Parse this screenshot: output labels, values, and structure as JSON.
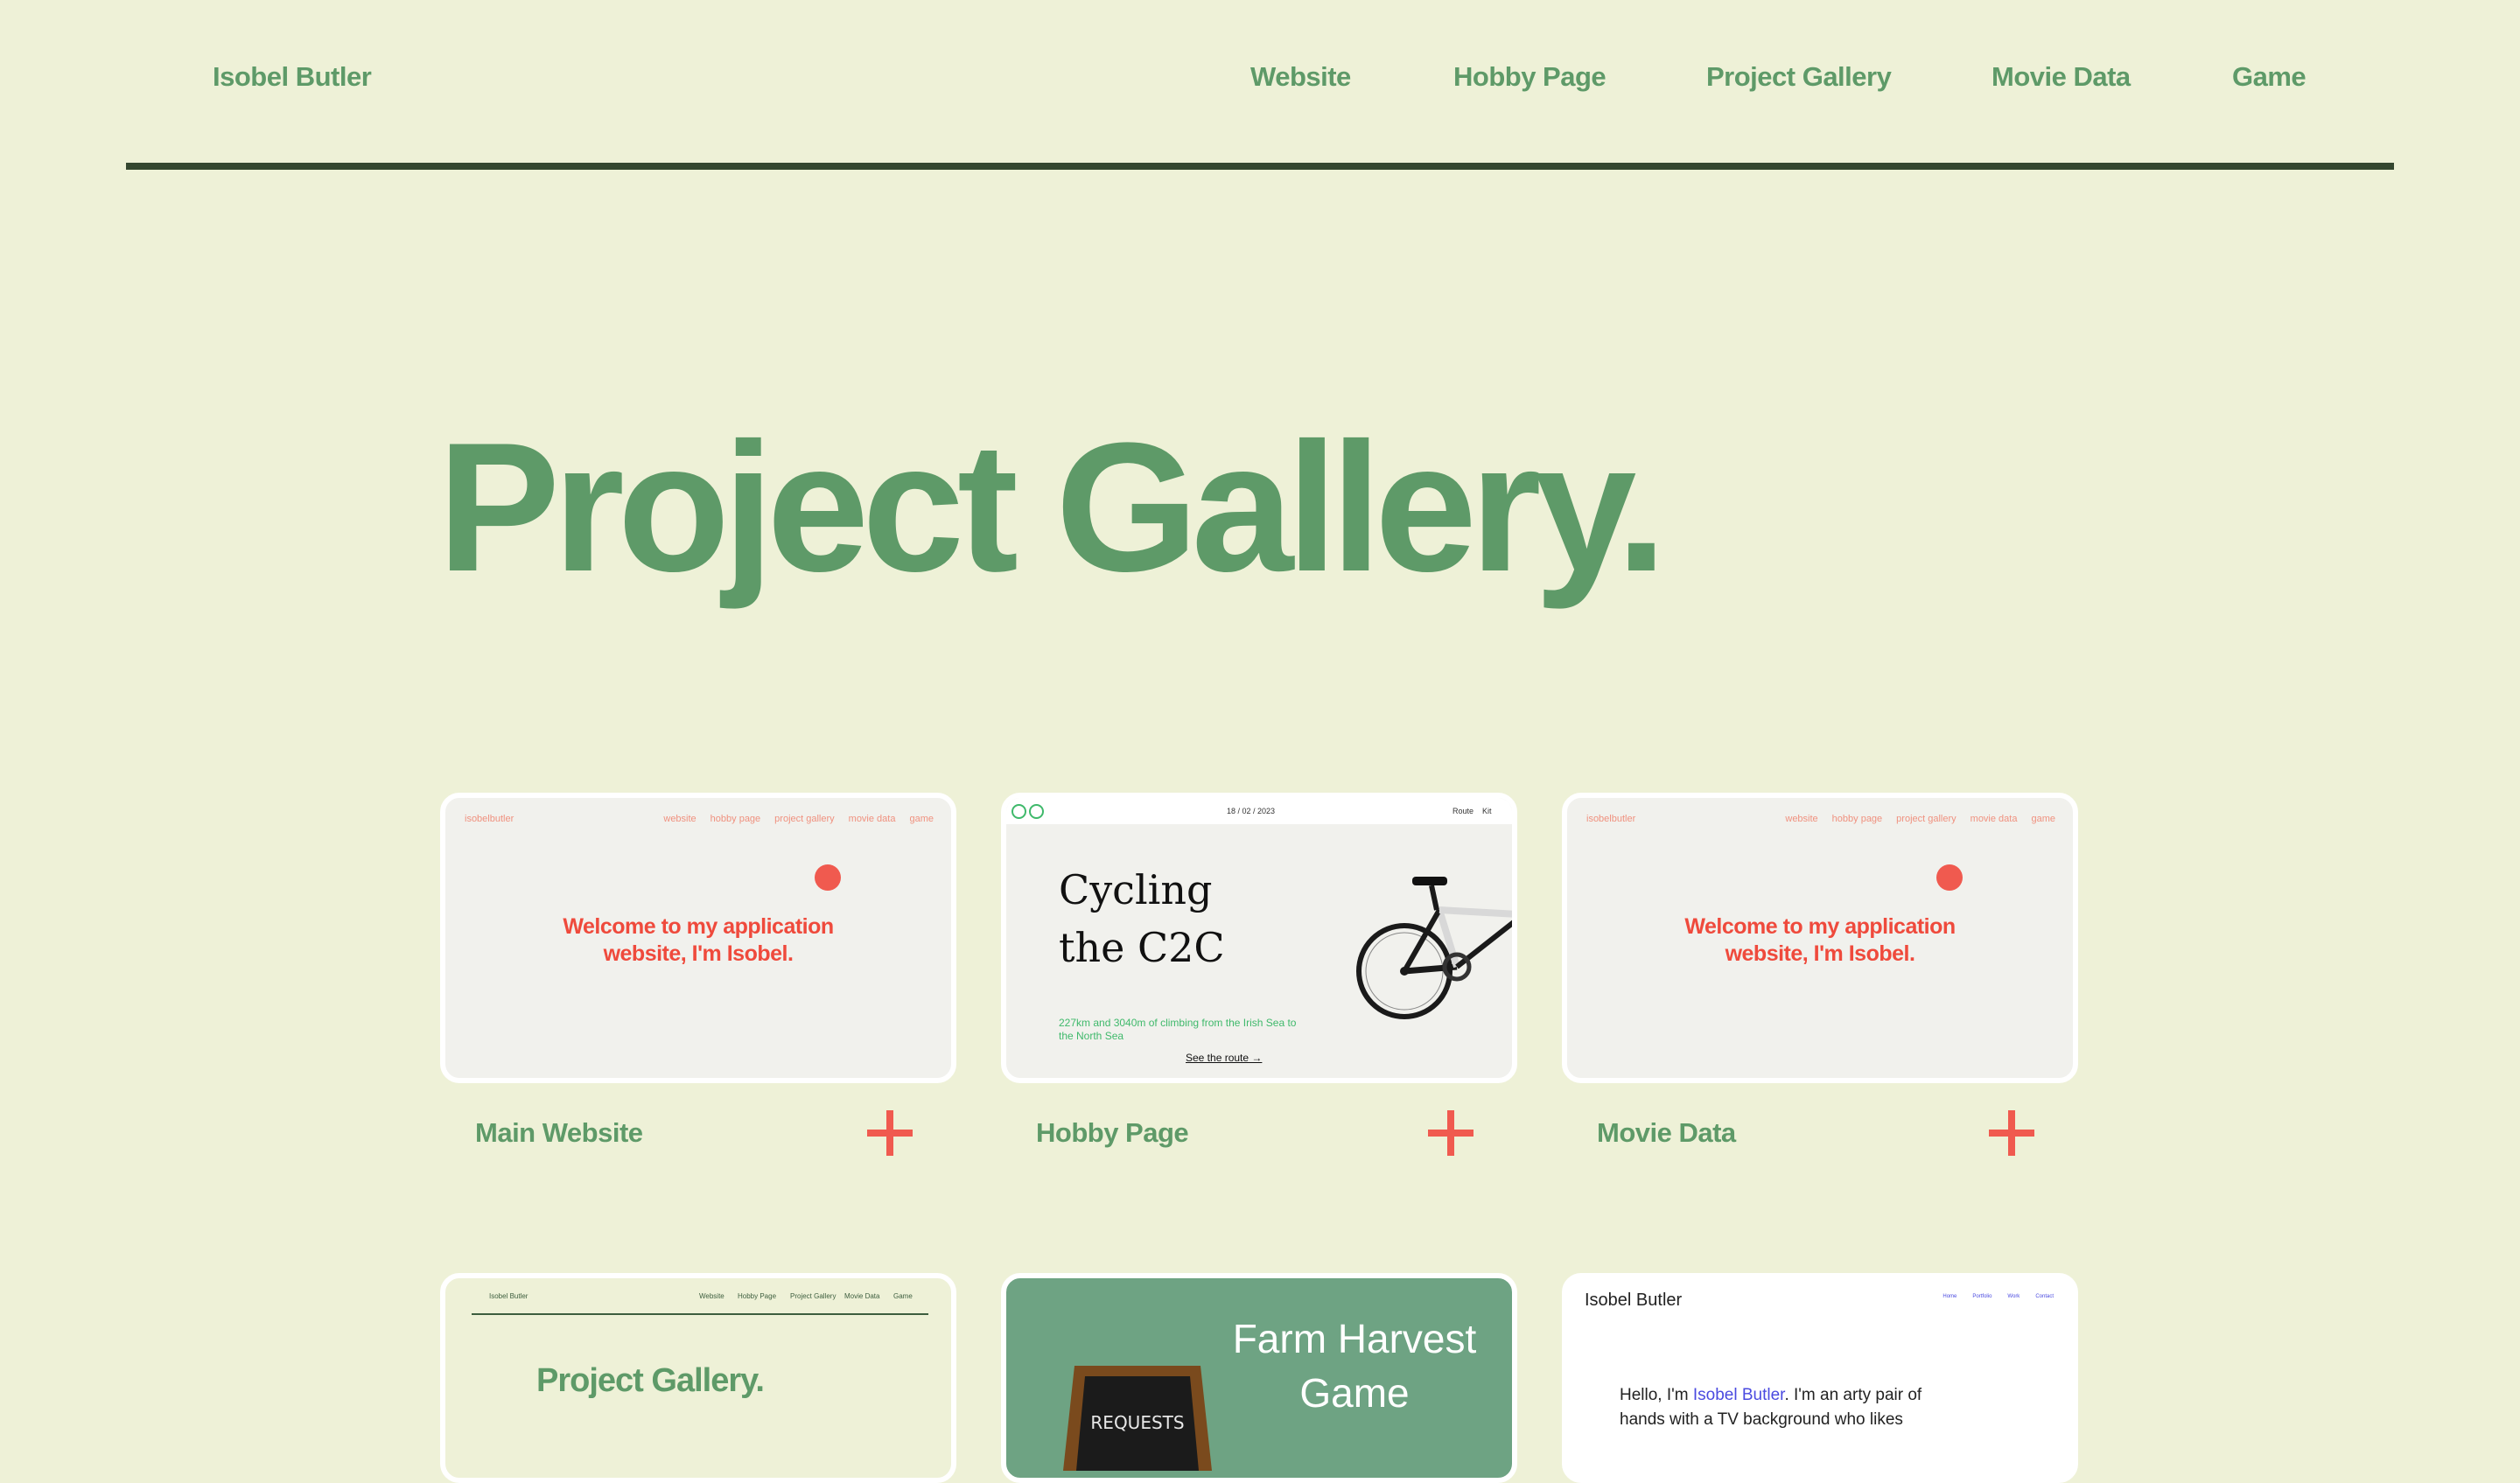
{
  "colors": {
    "background": "#eef1d7",
    "brand_green": "#5e9a68",
    "dark_rule": "#34472f",
    "accent_red": "#f05a4f"
  },
  "nav": {
    "brand": "Isobel Butler",
    "links": [
      "Website",
      "Hobby Page",
      "Project Gallery",
      "Movie Data",
      "Game"
    ]
  },
  "page_title": "Project Gallery.",
  "projects": [
    {
      "label": "Main Website",
      "preview": {
        "brand": "isobelbutler",
        "links": [
          "website",
          "hobby page",
          "project gallery",
          "movie data",
          "game"
        ],
        "welcome_line1": "Welcome to my application",
        "welcome_line2": "website, I'm Isobel."
      }
    },
    {
      "label": "Hobby Page",
      "preview": {
        "date": "18 / 02 / 2023",
        "route_label": "Route",
        "kit_label": "Kit",
        "title_line1": "Cycling",
        "title_line2": "the C2C",
        "subtitle": "227km and 3040m of climbing from the Irish Sea to the North Sea",
        "link": "See the route →"
      }
    },
    {
      "label": "Movie Data",
      "preview": {
        "brand": "isobelbutler",
        "links": [
          "website",
          "hobby page",
          "project gallery",
          "movie data",
          "game"
        ],
        "welcome_line1": "Welcome to my application",
        "welcome_line2": "website, I'm Isobel."
      }
    },
    {
      "preview": {
        "brand": "Isobel Butler",
        "links": [
          "Website",
          "Hobby Page",
          "Project Gallery",
          "Movie Data",
          "Game"
        ],
        "title": "Project Gallery."
      }
    },
    {
      "preview": {
        "title_line1": "Farm Harvest",
        "title_line2": "Game",
        "sign_text": "REQUESTS"
      }
    },
    {
      "preview": {
        "brand": "Isobel Butler",
        "links": [
          "Home",
          "Portfolio",
          "Work",
          "Contact"
        ],
        "intro_prefix": "Hello, I'm ",
        "intro_name": "Isobel Butler",
        "intro_suffix": ". I'm an arty pair of hands with a TV background who likes"
      }
    }
  ]
}
